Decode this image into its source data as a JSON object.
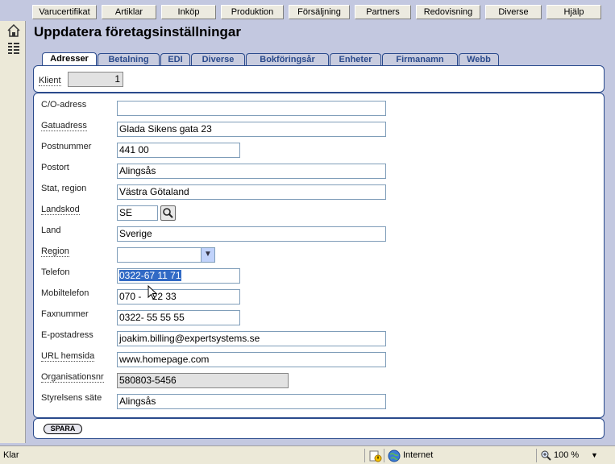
{
  "menu": [
    "Varucertifikat",
    "Artiklar",
    "Inköp",
    "Produktion",
    "Försäljning",
    "Partners",
    "Redovisning",
    "Diverse",
    "Hjälp"
  ],
  "page_title": "Uppdatera företagsinställningar",
  "tabs": [
    "Adresser",
    "Betalning",
    "EDI",
    "Diverse",
    "Bokföringsår",
    "Enheter",
    "Firmanamn",
    "Webb"
  ],
  "client": {
    "label": "Klient",
    "value": "1"
  },
  "fields": {
    "co_address": {
      "label": "C/O-adress",
      "value": ""
    },
    "street": {
      "label": "Gatuadress",
      "value": "Glada Sikens gata 23"
    },
    "postal_code": {
      "label": "Postnummer",
      "value": "441 00"
    },
    "city": {
      "label": "Postort",
      "value": "Alingsås"
    },
    "state": {
      "label": "Stat, region",
      "value": "Västra Götaland"
    },
    "country_code": {
      "label": "Landskod",
      "value": "SE"
    },
    "country": {
      "label": "Land",
      "value": "Sverige"
    },
    "region": {
      "label": "Region",
      "value": ""
    },
    "phone": {
      "label": "Telefon",
      "value": "0322-67 11 71"
    },
    "mobile": {
      "label": "Mobiltelefon",
      "value": "070 -    22 33"
    },
    "fax": {
      "label": "Faxnummer",
      "value": "0322- 55 55 55"
    },
    "email": {
      "label": "E-postadress",
      "value": "joakim.billing@expertsystems.se"
    },
    "url": {
      "label": "URL hemsida",
      "value": "www.homepage.com"
    },
    "org_no": {
      "label": "Organisationsnr",
      "value": "580803-5456"
    },
    "board_seat": {
      "label": "Styrelsens säte",
      "value": "Alingsås"
    }
  },
  "save_label": "SPARA",
  "status": {
    "text": "Klar",
    "zone": "Internet",
    "zoom": "100 %"
  }
}
